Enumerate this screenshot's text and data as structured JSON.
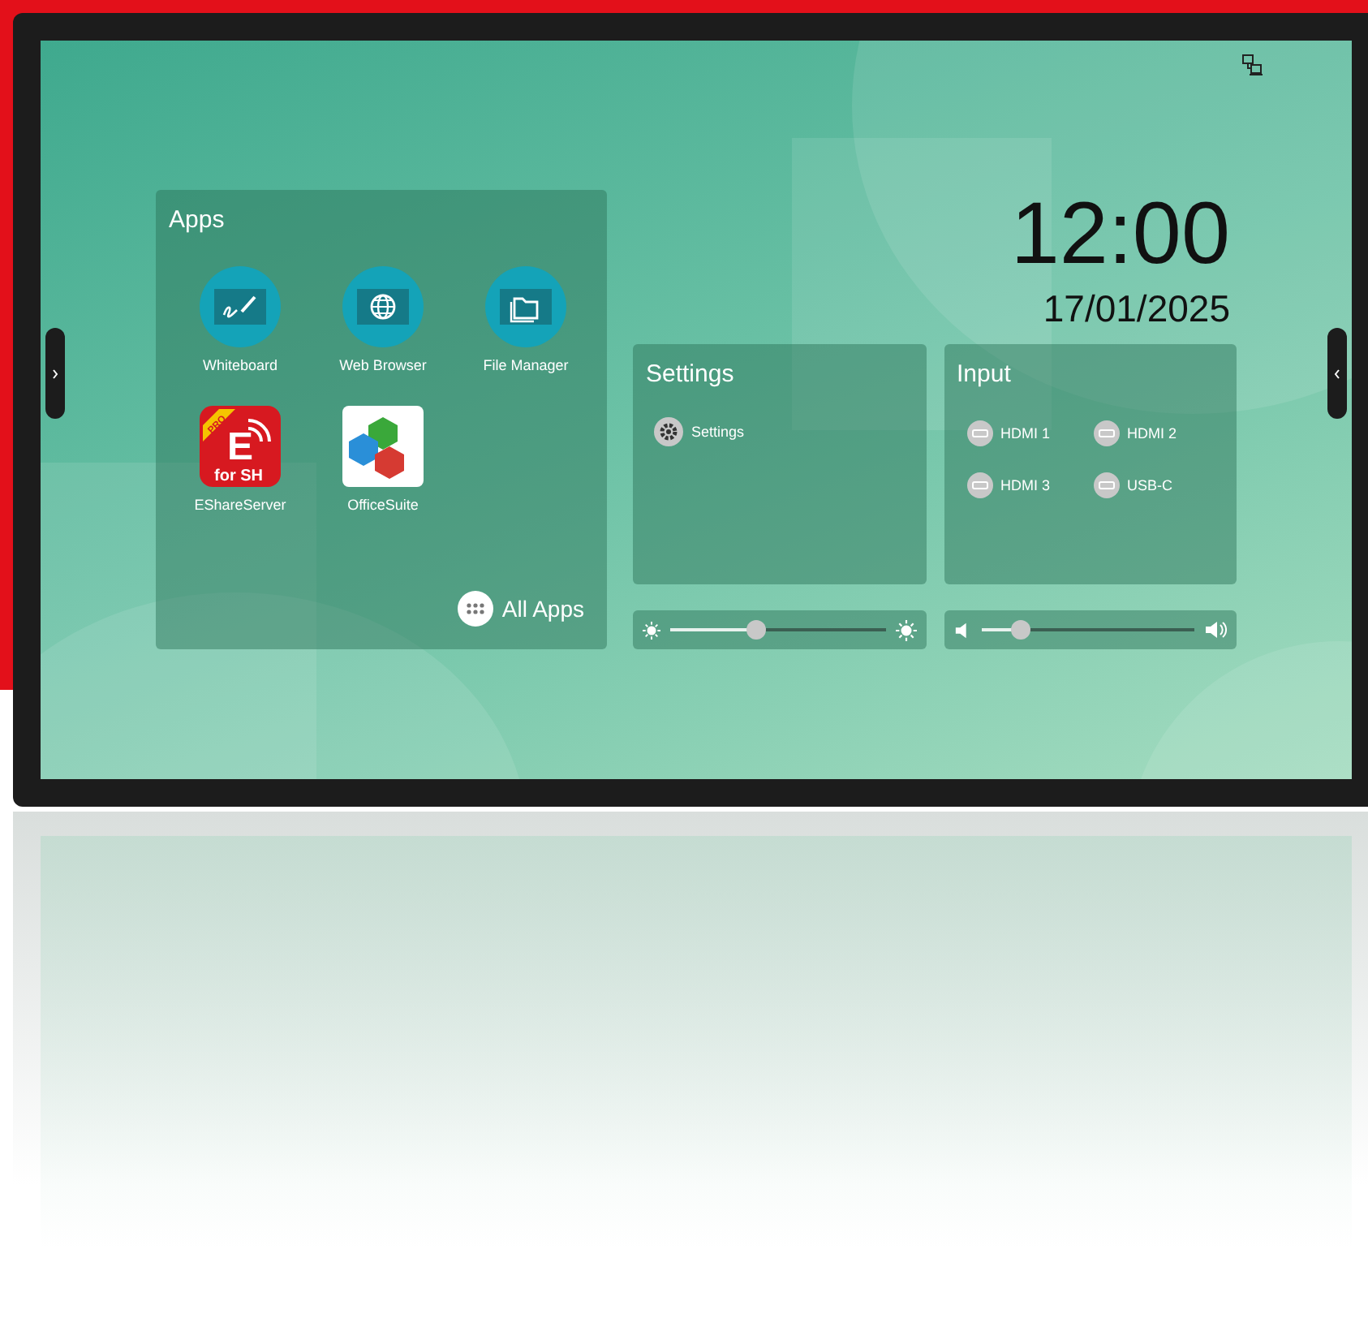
{
  "apps_panel": {
    "title": "Apps",
    "apps": [
      {
        "kind": "whiteboard",
        "label": "Whiteboard"
      },
      {
        "kind": "browser",
        "label": "Web Browser"
      },
      {
        "kind": "files",
        "label": "File Manager"
      },
      {
        "kind": "eshare",
        "label": "EShareServer",
        "logo_text": [
          "PRO",
          "E",
          "for SH"
        ]
      },
      {
        "kind": "office",
        "label": "OfficeSuite"
      }
    ],
    "all_apps": "All Apps"
  },
  "clock": {
    "time": "12:00",
    "date": "17/01/2025"
  },
  "settings_panel": {
    "title": "Settings",
    "items": [
      {
        "label": "Settings"
      }
    ]
  },
  "input_panel": {
    "title": "Input",
    "sources": [
      {
        "label": "HDMI 1"
      },
      {
        "label": "HDMI 2"
      },
      {
        "label": "HDMI 3"
      },
      {
        "label": "USB-C"
      }
    ]
  },
  "brightness": {
    "level": 0.4
  },
  "volume": {
    "level": 0.19
  }
}
